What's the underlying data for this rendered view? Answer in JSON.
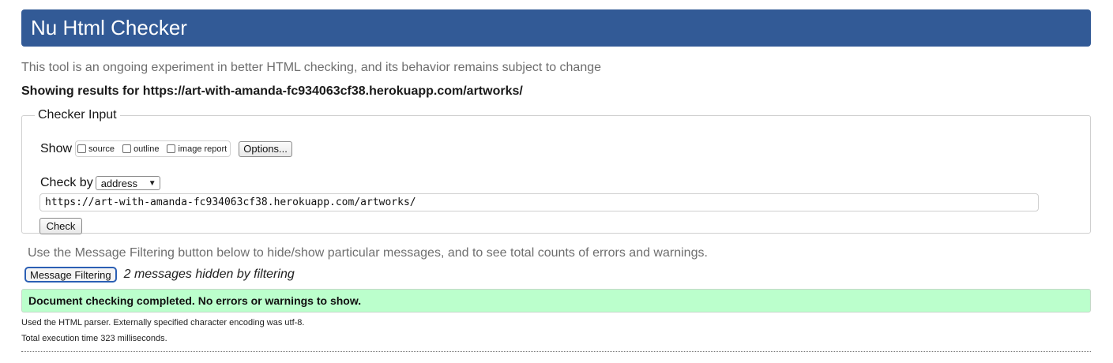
{
  "header": {
    "title": "Nu Html Checker"
  },
  "intro": "This tool is an ongoing experiment in better HTML checking, and its behavior remains subject to change",
  "results_for": "Showing results for https://art-with-amanda-fc934063cf38.herokuapp.com/artworks/",
  "checker_input": {
    "legend": "Checker Input",
    "show_label": "Show",
    "show_options": [
      {
        "label": "source",
        "checked": false
      },
      {
        "label": "outline",
        "checked": false
      },
      {
        "label": "image report",
        "checked": false
      }
    ],
    "options_button": "Options...",
    "check_by_label": "Check by",
    "check_by_value": "address",
    "url_value": "https://art-with-amanda-fc934063cf38.herokuapp.com/artworks/",
    "check_button": "Check"
  },
  "filtering": {
    "help_text": "Use the Message Filtering button below to hide/show particular messages, and to see total counts of errors and warnings.",
    "button_label": "Message Filtering",
    "hidden_count_text": "2 messages hidden by filtering"
  },
  "result": {
    "success_message": "Document checking completed. No errors or warnings to show.",
    "success_color": "#bbffcc",
    "parser_info": "Used the HTML parser. Externally specified character encoding was utf-8.",
    "execution_time": "Total execution time 323 milliseconds."
  },
  "colors": {
    "header_bg": "#325a96",
    "focus_outline": "#2b5fb4"
  }
}
